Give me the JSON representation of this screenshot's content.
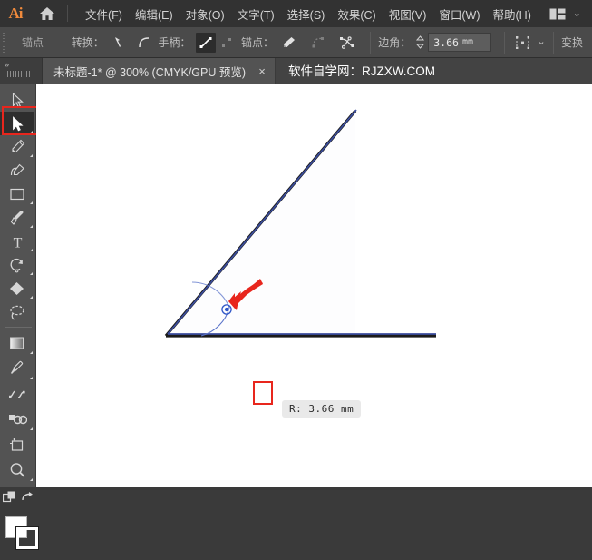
{
  "app": {
    "name": "Adobe Illustrator",
    "logo_text": "Ai",
    "accent_color": "#f08a3c",
    "highlight_color": "#e8261d"
  },
  "menubar": {
    "home_icon": "home-icon",
    "workspace_icon": "workspace-switcher-icon",
    "chevron": "⌄",
    "items": [
      {
        "label": "文件(F)",
        "name": "menu-file"
      },
      {
        "label": "编辑(E)",
        "name": "menu-edit"
      },
      {
        "label": "对象(O)",
        "name": "menu-object"
      },
      {
        "label": "文字(T)",
        "name": "menu-type"
      },
      {
        "label": "选择(S)",
        "name": "menu-select"
      },
      {
        "label": "效果(C)",
        "name": "menu-effect"
      },
      {
        "label": "视图(V)",
        "name": "menu-view"
      },
      {
        "label": "窗口(W)",
        "name": "menu-window"
      },
      {
        "label": "帮助(H)",
        "name": "menu-help"
      }
    ]
  },
  "optionsbar": {
    "context_label": "锚点",
    "convert_label": "转换：",
    "handle_label": "手柄：",
    "anchor_label": "锚点：",
    "corner_label": "边角：",
    "transform_label": "变换",
    "corner_value": "3.66",
    "corner_unit": "mm",
    "convert_tools": [
      {
        "name": "convert-to-corner-icon"
      },
      {
        "name": "convert-to-smooth-icon"
      }
    ],
    "handle_tools": [
      {
        "name": "show-handles-icon",
        "active": true
      },
      {
        "name": "hide-handles-icon",
        "active": false
      }
    ],
    "anchor_tools": [
      {
        "name": "remove-anchor-icon"
      },
      {
        "name": "connect-anchors-icon"
      },
      {
        "name": "cut-path-icon"
      }
    ],
    "align_icon": "align-panel-icon",
    "align_chevron": "⌄"
  },
  "tabbar": {
    "dock_arrows": "»",
    "document_title": "未标题-1* @ 300% (CMYK/GPU 预览)",
    "close_glyph": "×",
    "watermark": "软件自学网：RJZXW.COM"
  },
  "toolbar": {
    "selected_tool": "direct-selection-tool",
    "tools": [
      {
        "name": "selection-tool-icon",
        "selected": false,
        "flyout": false
      },
      {
        "name": "direct-selection-tool-icon",
        "selected": true,
        "flyout": true
      },
      {
        "name": "pen-tool-icon",
        "selected": false,
        "flyout": true
      },
      {
        "name": "curvature-tool-icon",
        "selected": false,
        "flyout": false
      },
      {
        "name": "rectangle-tool-icon",
        "selected": false,
        "flyout": true
      },
      {
        "name": "paintbrush-tool-icon",
        "selected": false,
        "flyout": true
      },
      {
        "name": "type-tool-icon",
        "selected": false,
        "flyout": true
      },
      {
        "name": "rotate-tool-icon",
        "selected": false,
        "flyout": true
      },
      {
        "name": "shape-builder-tool-icon",
        "selected": false,
        "flyout": true
      },
      {
        "name": "lasso-tool-icon",
        "selected": false,
        "flyout": false
      },
      {
        "name": "gradient-tool-icon",
        "selected": false,
        "flyout": true
      },
      {
        "name": "eyedropper-tool-icon",
        "selected": false,
        "flyout": true
      },
      {
        "name": "blend-tool-icon",
        "selected": false,
        "flyout": false
      },
      {
        "name": "symbol-sprayer-tool-icon",
        "selected": false,
        "flyout": true
      },
      {
        "name": "artboard-tool-icon",
        "selected": false,
        "flyout": false
      },
      {
        "name": "zoom-tool-icon",
        "selected": false,
        "flyout": true
      }
    ],
    "screen_mode_icon": "screen-mode-icon",
    "edit-toolbar_icon": "swap-fill-stroke-icon",
    "fill_color": "#ffffff",
    "stroke_color": "#000000"
  },
  "canvas": {
    "background": "#ffffff",
    "shape_name": "angle-path",
    "stroke_color_dark": "#1b1b1b",
    "path_selected_color": "#3b4d9e",
    "corner_widget": {
      "name": "live-corner-widget",
      "highlighted": true
    },
    "arrow_annotation": {
      "name": "red-arrow-annotation",
      "color": "#e8261d"
    },
    "tooltip": {
      "name": "radius-tooltip",
      "text": "R: 3.66 mm"
    }
  }
}
